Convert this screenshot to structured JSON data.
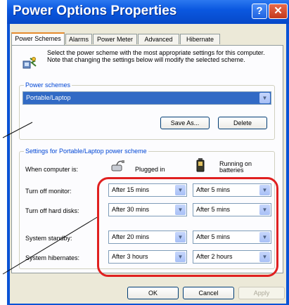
{
  "window": {
    "title": "Power Options Properties",
    "help_glyph": "?",
    "close_glyph": "✕"
  },
  "tabs": [
    {
      "label": "Power Schemes",
      "active": true
    },
    {
      "label": "Alarms"
    },
    {
      "label": "Power Meter"
    },
    {
      "label": "Advanced"
    },
    {
      "label": "Hibernate"
    }
  ],
  "intro": {
    "icon": "power-scheme-icon",
    "text": "Select the power scheme with the most appropriate settings for this computer. Note that changing the settings below will modify the selected scheme."
  },
  "schemes_group": {
    "title": "Power schemes",
    "selected_scheme": "Portable/Laptop",
    "save_as_label": "Save As...",
    "delete_label": "Delete"
  },
  "settings_group": {
    "title": "Settings for Portable/Laptop power scheme",
    "when_label": "When computer is:",
    "plugged_in_label": "Plugged in",
    "batteries_label": "Running on batteries",
    "rows": [
      {
        "label": "Turn off monitor:",
        "plugged": "After 15 mins",
        "battery": "After 5 mins"
      },
      {
        "label": "Turn off hard disks:",
        "plugged": "After 30 mins",
        "battery": "After 5 mins"
      },
      {
        "label": "System standby:",
        "plugged": "After 20 mins",
        "battery": "After 5 mins"
      },
      {
        "label": "System hibernates:",
        "plugged": "After 3 hours",
        "battery": "After 2 hours"
      }
    ]
  },
  "footer": {
    "ok_label": "OK",
    "cancel_label": "Cancel",
    "apply_label": "Apply"
  },
  "colors": {
    "title_bar": "#0b58e0",
    "highlight": "#e02020",
    "group_title": "#0046d5"
  }
}
